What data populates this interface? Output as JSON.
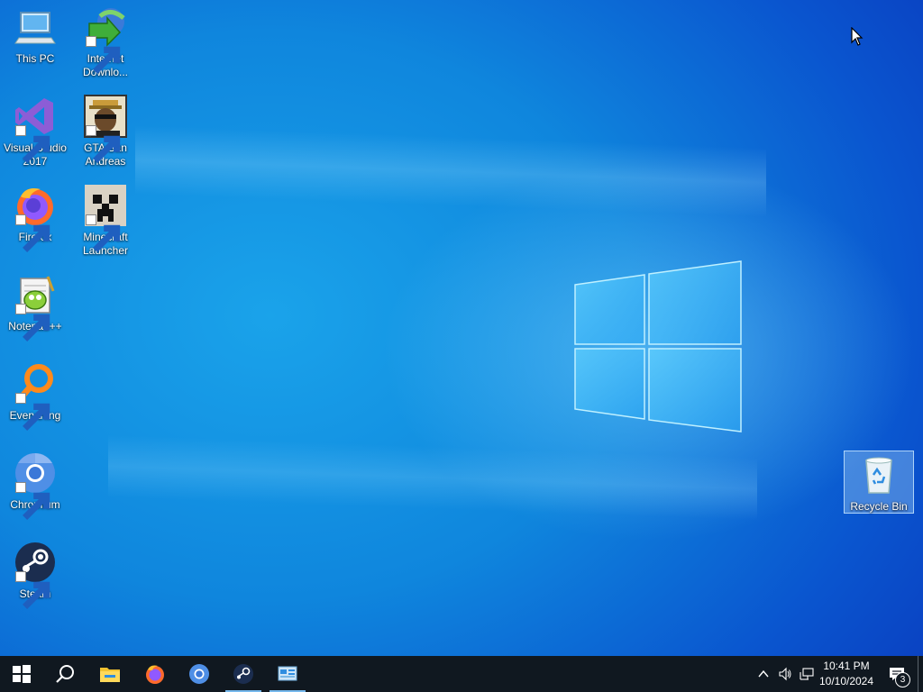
{
  "desktop_icons": [
    {
      "label": "This PC"
    },
    {
      "label": "Internet Downlo..."
    },
    {
      "label": "Visual Studio 2017"
    },
    {
      "label": "GTA San Andreas"
    },
    {
      "label": "Firefox"
    },
    {
      "label": "Minecraft Launcher"
    },
    {
      "label": "Notepad++"
    },
    {
      "label": "Everything"
    },
    {
      "label": "Chromium"
    },
    {
      "label": "Steam"
    },
    {
      "label": "Recycle Bin"
    }
  ],
  "taskbar": {
    "pinned": [
      "start-icon",
      "search-icon",
      "file-explorer-icon",
      "firefox-icon",
      "chromium-icon",
      "steam-icon",
      "control-panel-icon"
    ]
  },
  "tray": {
    "time": "10:41 PM",
    "date": "10/10/2024",
    "notification_count": "3"
  },
  "colors": {
    "taskbar": "#101820",
    "accent": "#76b9ed",
    "desktop": "#0f86dd"
  }
}
